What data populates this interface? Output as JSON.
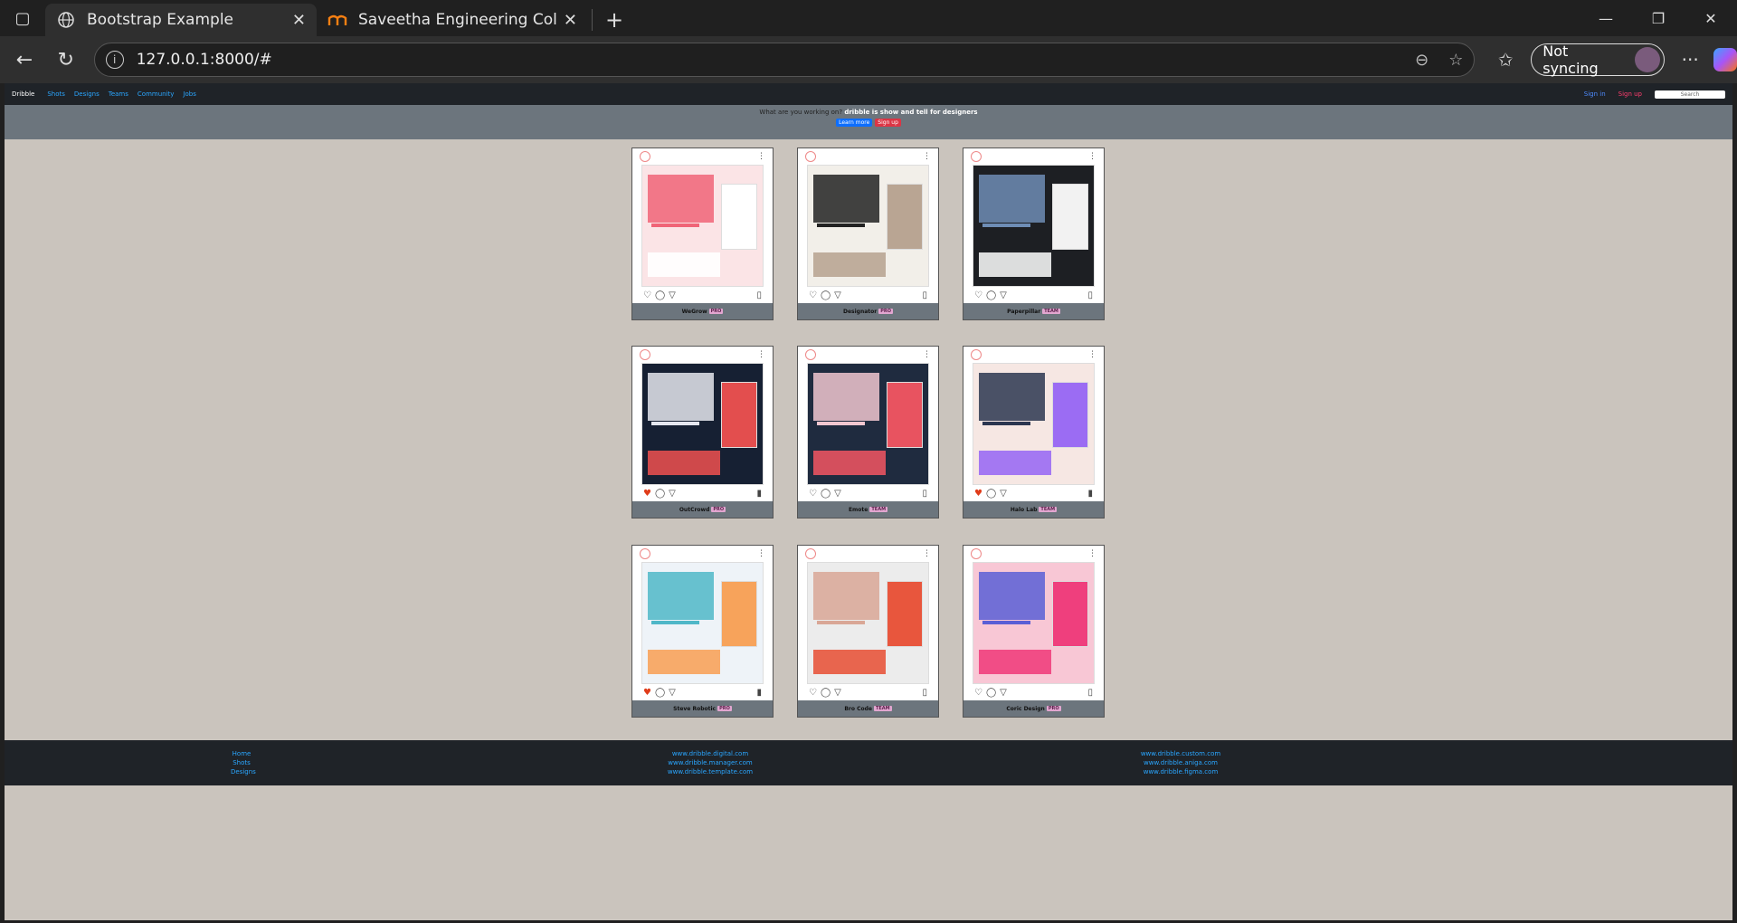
{
  "browser": {
    "tabs": [
      {
        "title": "Bootstrap Example",
        "active": true
      },
      {
        "title": "Saveetha Engineering College: Lo",
        "active": false
      }
    ],
    "url": "127.0.0.1:8000/#",
    "sync_label": "Not syncing"
  },
  "nav": {
    "brand": "Dribble",
    "links": [
      "Shots",
      "Designs",
      "Teams",
      "Community",
      "Jobs"
    ],
    "signin": "Sign in",
    "signup": "Sign up",
    "search_placeholder": "Search"
  },
  "hero": {
    "prefix": "What are you working on?",
    "highlight": "dribble is show and tell for designers",
    "learn_btn": "Learn more",
    "signup_btn": "Sign up"
  },
  "cards": [
    {
      "name": "WeGrow",
      "badge": "PRO",
      "liked": false,
      "saved": false,
      "palette": [
        "#fbe4e6",
        "#f06477",
        "#ffffff"
      ]
    },
    {
      "name": "Designator",
      "badge": "PRO",
      "liked": false,
      "saved": false,
      "palette": [
        "#f2efe9",
        "#222222",
        "#b9a593"
      ]
    },
    {
      "name": "Paperpillar",
      "badge": "TEAM",
      "liked": false,
      "saved": false,
      "palette": [
        "#1d1f23",
        "#6e8db5",
        "#f2f2f2"
      ]
    },
    {
      "name": "OutCrowd",
      "badge": "PRO",
      "liked": true,
      "saved": true,
      "palette": [
        "#162033",
        "#e5e7ef",
        "#e34e4e"
      ]
    },
    {
      "name": "Emote",
      "badge": "TEAM",
      "liked": false,
      "saved": false,
      "palette": [
        "#1f2b3f",
        "#f1c7d0",
        "#e85360"
      ]
    },
    {
      "name": "Halo Lab",
      "badge": "TEAM",
      "liked": true,
      "saved": true,
      "palette": [
        "#f6e7e3",
        "#2c3650",
        "#9b6cf3"
      ]
    },
    {
      "name": "Steve Robotic",
      "badge": "PRO",
      "liked": true,
      "saved": true,
      "palette": [
        "#eef3f8",
        "#4fb7c8",
        "#f7a35b"
      ]
    },
    {
      "name": "Bro Code",
      "badge": "TEAM",
      "liked": false,
      "saved": false,
      "palette": [
        "#ececec",
        "#d9a796",
        "#e8563d"
      ]
    },
    {
      "name": "Coric Design",
      "badge": "PRO",
      "liked": false,
      "saved": false,
      "palette": [
        "#f8c7d5",
        "#5a5fd6",
        "#ef3f7d"
      ]
    }
  ],
  "footer": {
    "col1": [
      "Home",
      "Shots",
      "Designs"
    ],
    "col2": [
      "www.dribble.digital.com",
      "www.dribble.manager.com",
      "www.dribble.template.com"
    ],
    "col3": [
      "www.dribble.custom.com",
      "www.dribble.aniga.com",
      "www.dribble.figma.com"
    ]
  }
}
